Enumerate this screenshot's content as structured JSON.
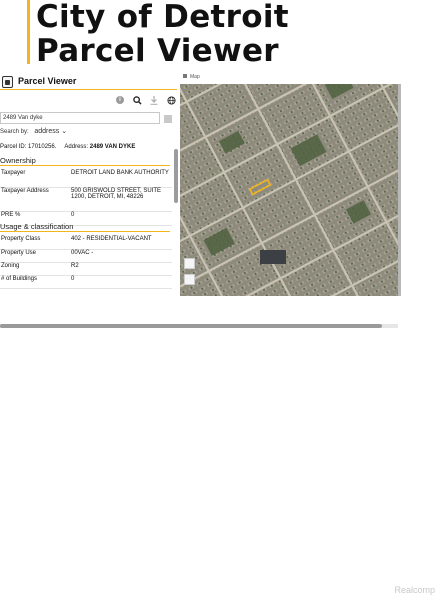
{
  "header": {
    "line1": "City of Detroit",
    "line2": "Parcel Viewer",
    "accent_color": "#f2b51c"
  },
  "app": {
    "title": "Parcel Viewer",
    "icons": [
      "info-icon",
      "search-icon",
      "download-icon",
      "globe-icon"
    ],
    "search": {
      "value": "2489 Van dyke"
    },
    "search_by": {
      "label": "Search by:",
      "selected": "address"
    },
    "parcel": {
      "id_label": "Parcel ID:",
      "id_value": "17010256.",
      "address_label": "Address:",
      "address_value": "2489 VAN DYKE"
    },
    "ownership": {
      "title": "Ownership",
      "rows": [
        {
          "key": "Taxpayer",
          "value": "DETROIT LAND BANK AUTHORITY"
        },
        {
          "key": "Taxpayer Address",
          "value": "500 GRISWOLD STREET, SUITE 1200, DETROIT, MI, 48226"
        },
        {
          "key": "PRE %",
          "value": "0"
        }
      ]
    },
    "usage": {
      "title": "Usage & classification",
      "rows": [
        {
          "key": "Property Class",
          "value": "402 - RESIDENTIAL-VACANT"
        },
        {
          "key": "Property Use",
          "value": "00VAC -"
        },
        {
          "key": "Zoning",
          "value": "R2"
        },
        {
          "key": "# of Buildings",
          "value": "0"
        }
      ]
    },
    "map": {
      "tab_label": "Map",
      "highlight_color": "#f2b51c"
    }
  },
  "watermark": "Realcomp"
}
